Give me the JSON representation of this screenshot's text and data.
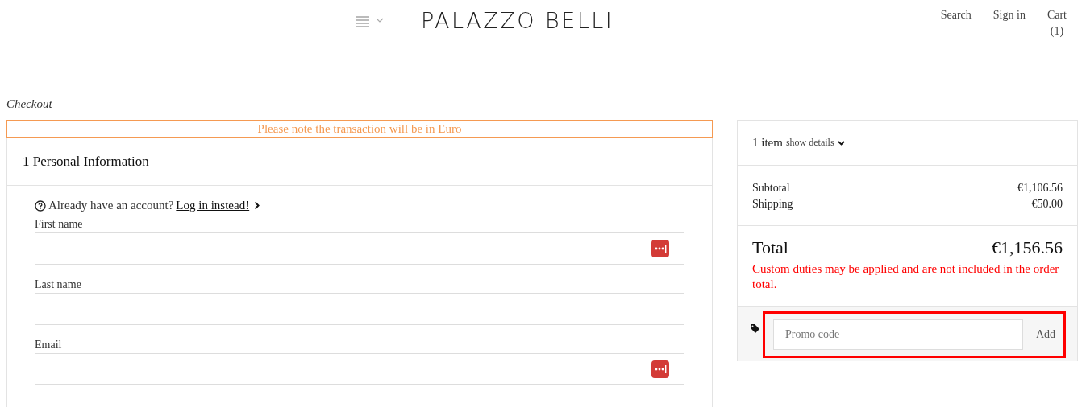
{
  "header": {
    "logo": "PALAZZO BELLI",
    "nav": [
      {
        "label": "Search"
      },
      {
        "label": "Sign in"
      },
      {
        "label": "Cart",
        "count": "(1)"
      }
    ]
  },
  "page_title": "Checkout",
  "notice": "Please note the transaction will be in Euro",
  "personal_information": {
    "step": "1 Personal Information",
    "account_prompt": "Already have an account?",
    "login_link": "Log in instead!",
    "fields": [
      {
        "label": "First name",
        "autofill_icon": true
      },
      {
        "label": "Last name",
        "autofill_icon": false
      },
      {
        "label": "Email",
        "autofill_icon": true
      }
    ]
  },
  "summary": {
    "items": "1 item",
    "show_details": "show details",
    "lines": [
      {
        "label": "Subtotal",
        "value": "€1,106.56"
      },
      {
        "label": "Shipping",
        "value": "€50.00"
      }
    ],
    "total_label": "Total",
    "total_value": "€1,156.56",
    "duties_note": "Custom duties may be applied and are not included in the order total.",
    "promo": {
      "placeholder": "Promo code",
      "button": "Add",
      "highlighted": true
    }
  }
}
